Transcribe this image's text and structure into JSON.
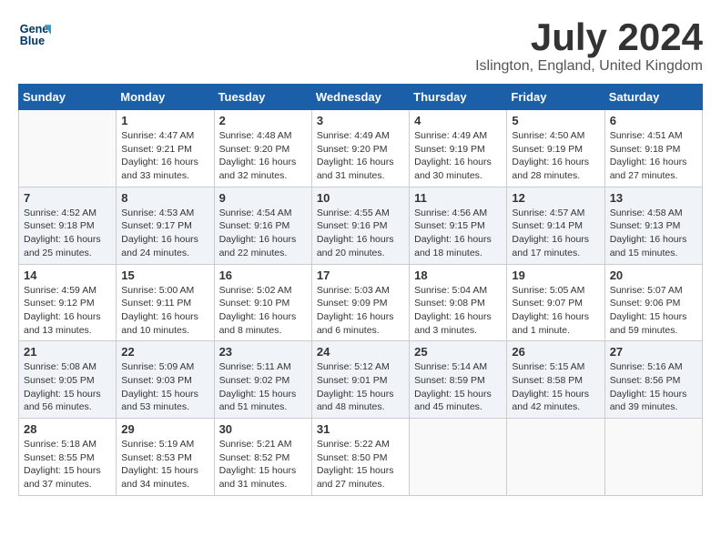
{
  "logo": {
    "line1": "General",
    "line2": "Blue"
  },
  "title": "July 2024",
  "subtitle": "Islington, England, United Kingdom",
  "days_of_week": [
    "Sunday",
    "Monday",
    "Tuesday",
    "Wednesday",
    "Thursday",
    "Friday",
    "Saturday"
  ],
  "weeks": [
    [
      {
        "day": "",
        "info": ""
      },
      {
        "day": "1",
        "info": "Sunrise: 4:47 AM\nSunset: 9:21 PM\nDaylight: 16 hours\nand 33 minutes."
      },
      {
        "day": "2",
        "info": "Sunrise: 4:48 AM\nSunset: 9:20 PM\nDaylight: 16 hours\nand 32 minutes."
      },
      {
        "day": "3",
        "info": "Sunrise: 4:49 AM\nSunset: 9:20 PM\nDaylight: 16 hours\nand 31 minutes."
      },
      {
        "day": "4",
        "info": "Sunrise: 4:49 AM\nSunset: 9:19 PM\nDaylight: 16 hours\nand 30 minutes."
      },
      {
        "day": "5",
        "info": "Sunrise: 4:50 AM\nSunset: 9:19 PM\nDaylight: 16 hours\nand 28 minutes."
      },
      {
        "day": "6",
        "info": "Sunrise: 4:51 AM\nSunset: 9:18 PM\nDaylight: 16 hours\nand 27 minutes."
      }
    ],
    [
      {
        "day": "7",
        "info": "Sunrise: 4:52 AM\nSunset: 9:18 PM\nDaylight: 16 hours\nand 25 minutes."
      },
      {
        "day": "8",
        "info": "Sunrise: 4:53 AM\nSunset: 9:17 PM\nDaylight: 16 hours\nand 24 minutes."
      },
      {
        "day": "9",
        "info": "Sunrise: 4:54 AM\nSunset: 9:16 PM\nDaylight: 16 hours\nand 22 minutes."
      },
      {
        "day": "10",
        "info": "Sunrise: 4:55 AM\nSunset: 9:16 PM\nDaylight: 16 hours\nand 20 minutes."
      },
      {
        "day": "11",
        "info": "Sunrise: 4:56 AM\nSunset: 9:15 PM\nDaylight: 16 hours\nand 18 minutes."
      },
      {
        "day": "12",
        "info": "Sunrise: 4:57 AM\nSunset: 9:14 PM\nDaylight: 16 hours\nand 17 minutes."
      },
      {
        "day": "13",
        "info": "Sunrise: 4:58 AM\nSunset: 9:13 PM\nDaylight: 16 hours\nand 15 minutes."
      }
    ],
    [
      {
        "day": "14",
        "info": "Sunrise: 4:59 AM\nSunset: 9:12 PM\nDaylight: 16 hours\nand 13 minutes."
      },
      {
        "day": "15",
        "info": "Sunrise: 5:00 AM\nSunset: 9:11 PM\nDaylight: 16 hours\nand 10 minutes."
      },
      {
        "day": "16",
        "info": "Sunrise: 5:02 AM\nSunset: 9:10 PM\nDaylight: 16 hours\nand 8 minutes."
      },
      {
        "day": "17",
        "info": "Sunrise: 5:03 AM\nSunset: 9:09 PM\nDaylight: 16 hours\nand 6 minutes."
      },
      {
        "day": "18",
        "info": "Sunrise: 5:04 AM\nSunset: 9:08 PM\nDaylight: 16 hours\nand 3 minutes."
      },
      {
        "day": "19",
        "info": "Sunrise: 5:05 AM\nSunset: 9:07 PM\nDaylight: 16 hours\nand 1 minute."
      },
      {
        "day": "20",
        "info": "Sunrise: 5:07 AM\nSunset: 9:06 PM\nDaylight: 15 hours\nand 59 minutes."
      }
    ],
    [
      {
        "day": "21",
        "info": "Sunrise: 5:08 AM\nSunset: 9:05 PM\nDaylight: 15 hours\nand 56 minutes."
      },
      {
        "day": "22",
        "info": "Sunrise: 5:09 AM\nSunset: 9:03 PM\nDaylight: 15 hours\nand 53 minutes."
      },
      {
        "day": "23",
        "info": "Sunrise: 5:11 AM\nSunset: 9:02 PM\nDaylight: 15 hours\nand 51 minutes."
      },
      {
        "day": "24",
        "info": "Sunrise: 5:12 AM\nSunset: 9:01 PM\nDaylight: 15 hours\nand 48 minutes."
      },
      {
        "day": "25",
        "info": "Sunrise: 5:14 AM\nSunset: 8:59 PM\nDaylight: 15 hours\nand 45 minutes."
      },
      {
        "day": "26",
        "info": "Sunrise: 5:15 AM\nSunset: 8:58 PM\nDaylight: 15 hours\nand 42 minutes."
      },
      {
        "day": "27",
        "info": "Sunrise: 5:16 AM\nSunset: 8:56 PM\nDaylight: 15 hours\nand 39 minutes."
      }
    ],
    [
      {
        "day": "28",
        "info": "Sunrise: 5:18 AM\nSunset: 8:55 PM\nDaylight: 15 hours\nand 37 minutes."
      },
      {
        "day": "29",
        "info": "Sunrise: 5:19 AM\nSunset: 8:53 PM\nDaylight: 15 hours\nand 34 minutes."
      },
      {
        "day": "30",
        "info": "Sunrise: 5:21 AM\nSunset: 8:52 PM\nDaylight: 15 hours\nand 31 minutes."
      },
      {
        "day": "31",
        "info": "Sunrise: 5:22 AM\nSunset: 8:50 PM\nDaylight: 15 hours\nand 27 minutes."
      },
      {
        "day": "",
        "info": ""
      },
      {
        "day": "",
        "info": ""
      },
      {
        "day": "",
        "info": ""
      }
    ]
  ]
}
